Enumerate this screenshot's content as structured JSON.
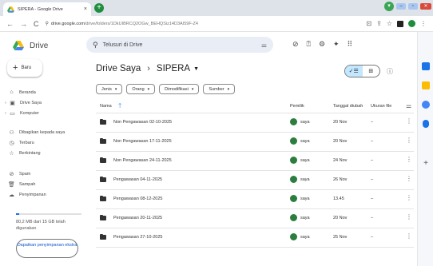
{
  "browser": {
    "tab_title": "SIPERA - Google Drive",
    "tab_close": "×",
    "new_tab": "+",
    "url_host": "drive.google.com",
    "url_path": "/drive/folders/1DkUIBRCQ2OGw_BEHQSiz14D3AI59F-Z4"
  },
  "header": {
    "brand": "Drive",
    "search_placeholder": "Telusuri di Drive"
  },
  "sidebar": {
    "new_label": "Baru",
    "items": [
      {
        "label": "Beranda",
        "icon": "home-icon"
      },
      {
        "label": "Drive Saya",
        "icon": "my-drive-icon"
      },
      {
        "label": "Komputer",
        "icon": "computer-icon"
      },
      {
        "label": "Dibagikan kepada saya",
        "icon": "shared-icon"
      },
      {
        "label": "Terbaru",
        "icon": "clock-icon"
      },
      {
        "label": "Berbintang",
        "icon": "star-icon"
      },
      {
        "label": "Spam",
        "icon": "spam-icon"
      },
      {
        "label": "Sampah",
        "icon": "trash-icon"
      },
      {
        "label": "Penyimpanan",
        "icon": "cloud-icon"
      }
    ],
    "storage_fraction": 0.05,
    "storage_text": "80,2 MB dari 15 GB telah digunakan",
    "get_more_storage": "Dapatkan penyimpanan ekstra"
  },
  "main": {
    "breadcrumb_root": "Drive Saya",
    "breadcrumb_current": "SIPERA",
    "filters": [
      "Jenis",
      "Orang",
      "Dimodifikasi",
      "Sumber"
    ],
    "columns": {
      "name": "Nama",
      "owner": "Pemilik",
      "modified": "Tanggal diubah",
      "size": "Ukuran file"
    },
    "rows": [
      {
        "name": "Non Pengawasan 02-10-2025",
        "owner": "saya",
        "modified": "20 Nov",
        "size": "–"
      },
      {
        "name": "Non Pengawasan 17-11-2025",
        "owner": "saya",
        "modified": "20 Nov",
        "size": "–"
      },
      {
        "name": "Non Pengawasan 24-11-2025",
        "owner": "saya",
        "modified": "24 Nov",
        "size": "–"
      },
      {
        "name": "Pengawasan 04-11-2025",
        "owner": "saya",
        "modified": "26 Nov",
        "size": "–"
      },
      {
        "name": "Pengawasan 08-12-2025",
        "owner": "saya",
        "modified": "13.45",
        "size": "–"
      },
      {
        "name": "Pengawasan 20-11-2025",
        "owner": "saya",
        "modified": "20 Nov",
        "size": "–"
      },
      {
        "name": "Pengawasan 27-10-2025",
        "owner": "saya",
        "modified": "25 Nov",
        "size": "–"
      }
    ]
  },
  "colors": {
    "accent": "#1a73e8",
    "search_bg": "#e9eef6",
    "toggle_on": "#c2e7ff",
    "avatar": "#2c7d3e"
  }
}
